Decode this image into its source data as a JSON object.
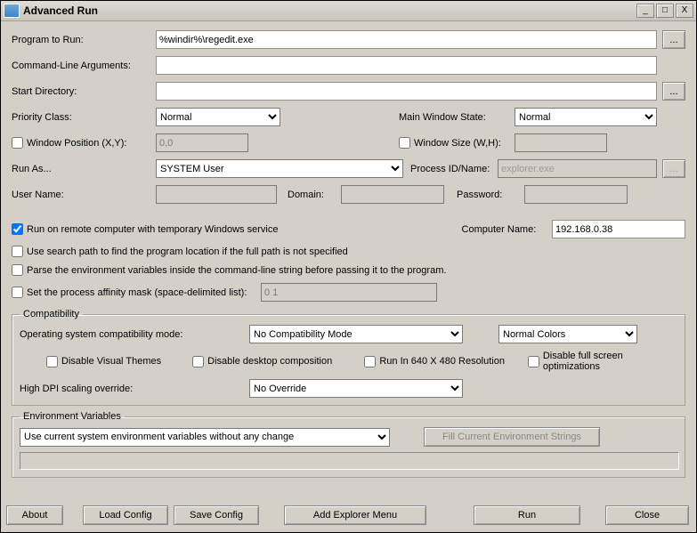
{
  "window": {
    "title": "Advanced Run"
  },
  "titlebar": {
    "minimize": "_",
    "maximize": "□",
    "close": "X"
  },
  "labels": {
    "program": "Program to Run:",
    "args": "Command-Line Arguments:",
    "startdir": "Start Directory:",
    "priority": "Priority Class:",
    "mainwin": "Main Window State:",
    "winpos": "Window Position (X,Y):",
    "winsize": "Window Size (W,H):",
    "runas": "Run As...",
    "procid": "Process ID/Name:",
    "user": "User Name:",
    "domain": "Domain:",
    "password": "Password:",
    "remote": "Run on remote computer with temporary Windows service",
    "compname": "Computer Name:",
    "searchpath": "Use search path to find the program location if the full path is not specified",
    "parseenv": "Parse the environment variables inside the command-line string before passing it to the program.",
    "affinity": "Set the process affinity mask (space-delimited list):",
    "compat_legend": "Compatibility",
    "osmode": "Operating system compatibility mode:",
    "disable_themes": "Disable Visual Themes",
    "disable_dwm": "Disable desktop composition",
    "run640": "Run In 640 X 480 Resolution",
    "disable_fso": "Disable full screen optimizations",
    "dpi": "High DPI scaling override:",
    "env_legend": "Environment Variables"
  },
  "values": {
    "program": "%windir%\\regedit.exe",
    "args": "",
    "startdir": "",
    "priority": "Normal",
    "mainwin": "Normal",
    "winpos": "0,0",
    "winsize": "",
    "runas": "SYSTEM User",
    "procid_placeholder": "explorer.exe",
    "user": "",
    "domain": "",
    "password": "",
    "compname": "192.168.0.38",
    "affinity": "0 1",
    "osmode": "No Compatibility Mode",
    "colors": "Normal Colors",
    "dpi": "No Override",
    "env": "Use current system environment variables without any change"
  },
  "buttons": {
    "browse": "...",
    "fillenv": "Fill Current Environment Strings",
    "about": "About",
    "load": "Load Config",
    "save": "Save Config",
    "addmenu": "Add Explorer Menu",
    "run": "Run",
    "close": "Close"
  }
}
